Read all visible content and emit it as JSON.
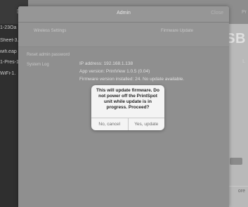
{
  "background": {
    "sidebar": {
      "header": "Do",
      "items": [
        {
          "label": "1-23Oa",
          "sub": ""
        },
        {
          "label": "Sheet-3.",
          "sub": ""
        },
        {
          "label": "wifi.eap",
          "sub": ""
        },
        {
          "label": "1-Pres-1",
          "sub": ""
        },
        {
          "label": "WiFi-1.",
          "sub": ""
        }
      ]
    },
    "topbar_right": "Pr",
    "letters": "SB",
    "side_text": "L",
    "bottom_text": "ore"
  },
  "admin": {
    "title": "Admin",
    "close_label": "Close",
    "tabs": {
      "wireless": "Wireless Settings",
      "firmware": "Firmware Update"
    },
    "reset_password": "Reset admin password",
    "system_log": "System Log",
    "ip": "IP address: 192.168.1.138",
    "app_version": "App version: PrintView 1.0.5 (0.04)",
    "firmware_status": "Firmware version installed: 24.  No update available."
  },
  "alert": {
    "message": "This will update firmware.  Do not power off the PrintSpot unit while update is in progress. Proceed?",
    "cancel_label": "No, cancel",
    "confirm_label": "Yes, update"
  }
}
